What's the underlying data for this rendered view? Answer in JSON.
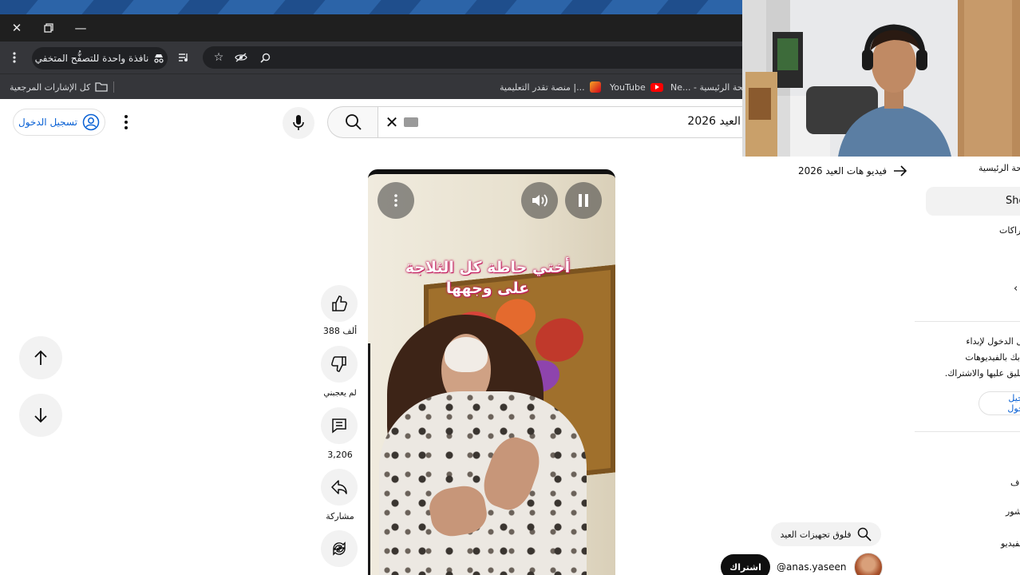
{
  "browser": {
    "incognito_label": "نافذة واحدة للتصفُّح المتخفي",
    "bookmarks": [
      {
        "label": "كل الإشارات المرجعية"
      },
      {
        "label": "منصة تقدر التعليمية |..."
      },
      {
        "label": "YouTube"
      },
      {
        "label": "Ne... - صفحة الرئيسية"
      }
    ]
  },
  "header": {
    "signin_label": "تسجيل الدخول",
    "search_value": "العيد 2026"
  },
  "video": {
    "caption_line1": "أختي حاطة كل الثلاجة",
    "caption_line2": "على وجهها"
  },
  "actions": {
    "likes": "388 ألف",
    "dislike": "لم يعجبني",
    "comments": "3,206",
    "share": "مشاركة"
  },
  "sidebar": {
    "related_link": "فيديو هات العيد 2026",
    "home": "الصفحة الرئيسية",
    "shorts": "Shorts",
    "subscriptions": "الاشتراكات",
    "signin_prompt": "سجّل الدخول لإبداء إعجابك بالفيديوهات والتعليق عليها والاشتراك.",
    "signin_button": "تسجيل الدخول",
    "item_a": "استكشاف",
    "item_b": "رائج الآن والمنشور",
    "item_c": "الفيديو"
  },
  "channel": {
    "search_chip": "فلوق تجهيزات العيد",
    "name": "@anas.yaseen",
    "subscribe": "اشتراك"
  },
  "colors": {
    "accent_blue": "#065fd4",
    "chrome_dark": "#35363a",
    "youtube_red": "#ff0000"
  }
}
